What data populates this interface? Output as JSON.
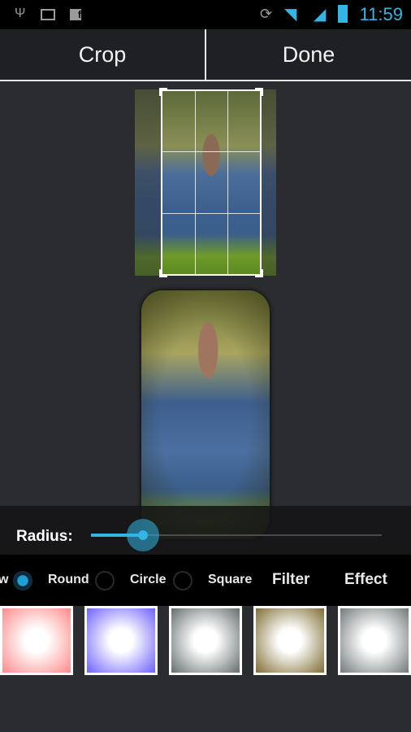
{
  "status_bar": {
    "icons": [
      "usb-icon",
      "image-icon",
      "facebook-icon",
      "rotation-lock-icon",
      "wifi-icon",
      "signal-icon",
      "battery-icon"
    ],
    "time": "11:59",
    "accent": "#33b5e5"
  },
  "toolbar": {
    "crop_label": "Crop",
    "done_label": "Done"
  },
  "radius": {
    "label": "Radius:",
    "value_percent": 18
  },
  "options": {
    "partial_label": "w",
    "round": "Round",
    "circle": "Circle",
    "square": "Square",
    "filter": "Filter",
    "effect": "Effect",
    "selected": "w"
  },
  "swatches": [
    {
      "name": "red",
      "color": "#ff7a7a"
    },
    {
      "name": "blue",
      "color": "#5a4cff"
    },
    {
      "name": "gray",
      "color": "#4e5a5a"
    },
    {
      "name": "sepia",
      "color": "#6e5a18"
    },
    {
      "name": "slate",
      "color": "#5e6868"
    }
  ]
}
